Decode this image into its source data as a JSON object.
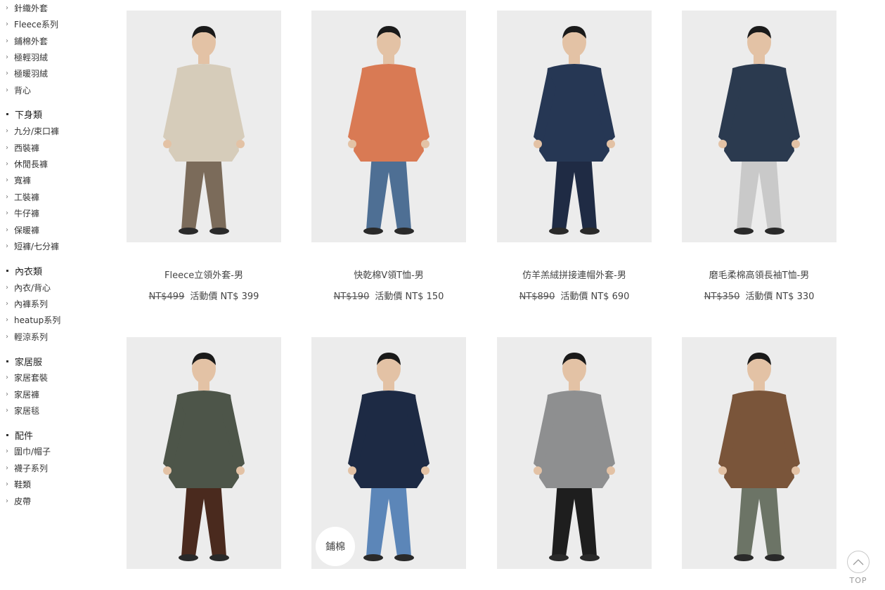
{
  "sidebar": {
    "groups": [
      {
        "items": [
          "針織外套",
          "Fleece系列",
          "鋪棉外套",
          "極輕羽絨",
          "極暖羽絨",
          "背心"
        ]
      },
      {
        "heading": "下身類",
        "items": [
          "九分/束口褲",
          "西裝褲",
          "休閒長褲",
          "寬褲",
          "工裝褲",
          "牛仔褲",
          "保暖褲",
          "短褲/七分褲"
        ]
      },
      {
        "heading": "內衣類",
        "items": [
          "內衣/背心",
          "內褲系列",
          "heatup系列",
          "輕涼系列"
        ]
      },
      {
        "heading": "家居服",
        "items": [
          "家居套裝",
          "家居褲",
          "家居毯"
        ]
      },
      {
        "heading": "配件",
        "items": [
          "圍巾/帽子",
          "襪子系列",
          "鞋類",
          "皮帶"
        ]
      }
    ]
  },
  "products": [
    {
      "name": "Fleece立領外套-男",
      "original_price": "NT$499",
      "promo_label": "活動價",
      "promo_price": "NT$ 399"
    },
    {
      "name": "快乾棉V領T恤-男",
      "original_price": "NT$190",
      "promo_label": "活動價",
      "promo_price": "NT$ 150"
    },
    {
      "name": "仿羊羔絨拼接連帽外套-男",
      "original_price": "NT$890",
      "promo_label": "活動價",
      "promo_price": "NT$ 690"
    },
    {
      "name": "磨毛柔棉高領長袖T恤-男",
      "original_price": "NT$350",
      "promo_label": "活動價",
      "promo_price": "NT$ 330"
    },
    {
      "name": "",
      "original_price": "",
      "promo_label": "",
      "promo_price": ""
    },
    {
      "name": "",
      "original_price": "",
      "promo_label": "",
      "promo_price": "",
      "badge": "鋪棉"
    },
    {
      "name": "",
      "original_price": "",
      "promo_label": "",
      "promo_price": ""
    },
    {
      "name": "",
      "original_price": "",
      "promo_label": "",
      "promo_price": ""
    }
  ],
  "back_to_top": {
    "label": "TOP",
    "icon": "chevron-up-icon"
  },
  "colors": {
    "text": "#333333",
    "photo_bg": "#ececec",
    "outfits": [
      {
        "top": "#d6ccba",
        "bottom": "#7b6b5a"
      },
      {
        "top": "#d97a54",
        "bottom": "#4e6f94"
      },
      {
        "top": "#263754",
        "bottom": "#1f2b44"
      },
      {
        "top": "#2b3a4f",
        "bottom": "#c9c9c9"
      },
      {
        "top": "#4d5549",
        "bottom": "#4a2a1e"
      },
      {
        "top": "#1d2a44",
        "bottom": "#5c86b8"
      },
      {
        "top": "#8e8f90",
        "bottom": "#1e1e1e"
      },
      {
        "top": "#7a553a",
        "bottom": "#6c7466"
      }
    ]
  }
}
